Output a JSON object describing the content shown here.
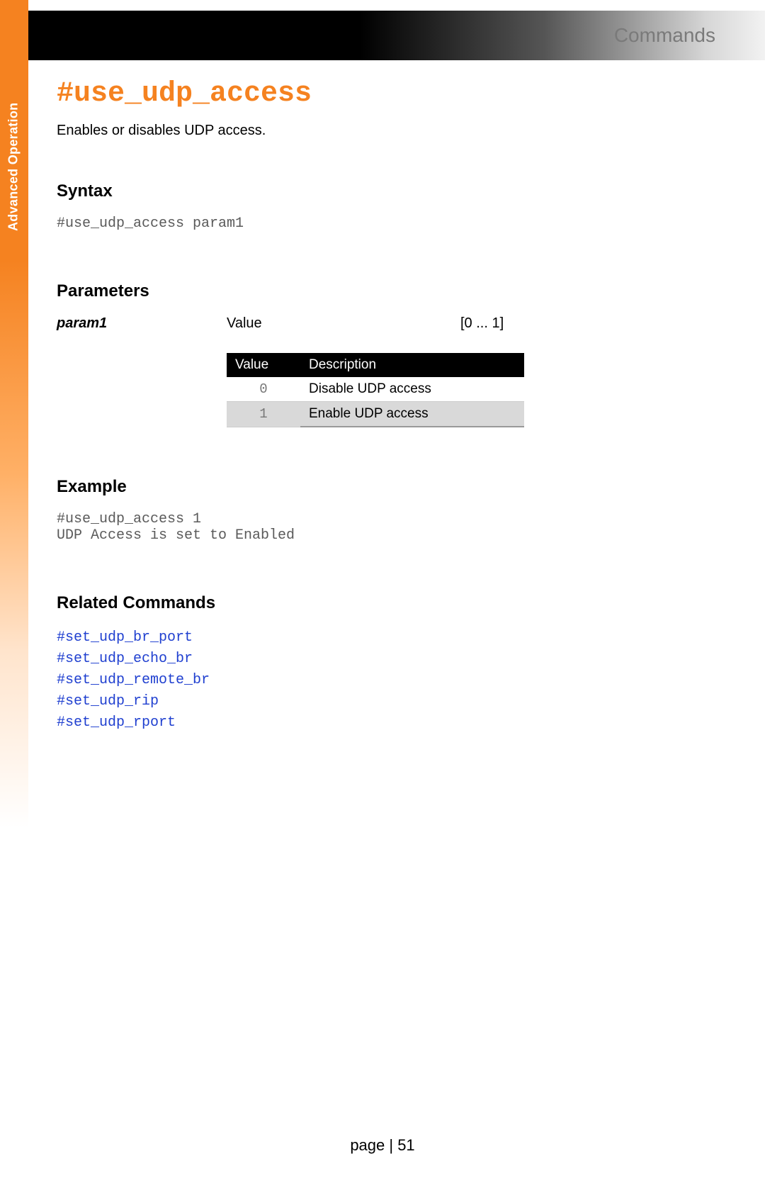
{
  "header": {
    "category": "Commands"
  },
  "sidebar": {
    "label": "Advanced Operation"
  },
  "command": {
    "title": "#use_udp_access",
    "description": "Enables or disables UDP access."
  },
  "sections": {
    "syntax": {
      "heading": "Syntax",
      "code": "#use_udp_access param1"
    },
    "parameters": {
      "heading": "Parameters",
      "param_name": "param1",
      "param_type": "Value",
      "param_range": "[0 ... 1]",
      "table": {
        "col_value": "Value",
        "col_desc": "Description",
        "rows": [
          {
            "value": "0",
            "desc": "Disable UDP access"
          },
          {
            "value": "1",
            "desc": "Enable UDP access"
          }
        ]
      }
    },
    "example": {
      "heading": "Example",
      "code": "#use_udp_access 1\nUDP Access is set to Enabled"
    },
    "related": {
      "heading": "Related Commands",
      "items": [
        "#set_udp_br_port",
        "#set_udp_echo_br",
        "#set_udp_remote_br",
        "#set_udp_rip",
        "#set_udp_rport"
      ]
    }
  },
  "footer": {
    "page_label": "page | 51"
  }
}
